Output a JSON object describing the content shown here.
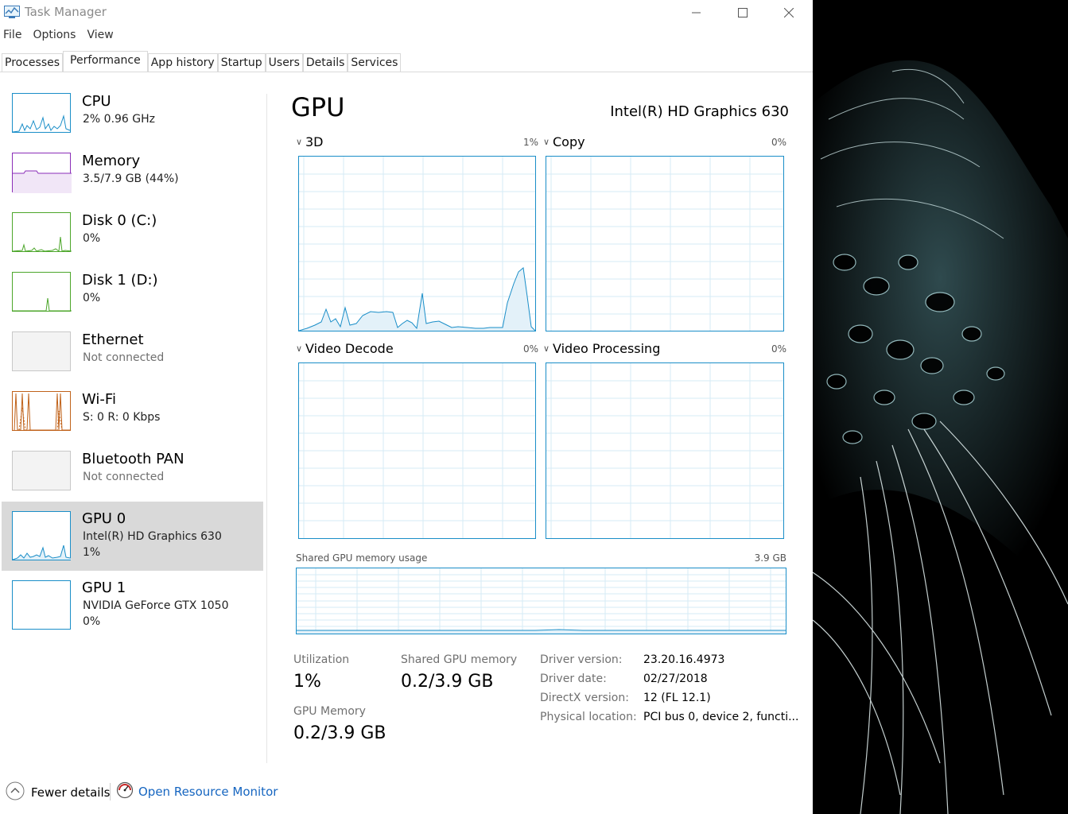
{
  "window": {
    "title": "Task Manager",
    "controls": {
      "minimize": "minimize-icon",
      "maximize": "maximize-icon",
      "close": "close-icon"
    }
  },
  "menu": {
    "items": [
      "File",
      "Options",
      "View"
    ]
  },
  "tabs": {
    "items": [
      "Processes",
      "Performance",
      "App history",
      "Startup",
      "Users",
      "Details",
      "Services"
    ],
    "active": "Performance"
  },
  "sidebar": {
    "items": [
      {
        "name": "CPU",
        "sub1": "2%  0.96 GHz",
        "sub2": "",
        "color": "#1a8ec8"
      },
      {
        "name": "Memory",
        "sub1": "3.5/7.9 GB (44%)",
        "sub2": "",
        "color": "#8b2eb8"
      },
      {
        "name": "Disk 0 (C:)",
        "sub1": "0%",
        "sub2": "",
        "color": "#4ca62a"
      },
      {
        "name": "Disk 1 (D:)",
        "sub1": "0%",
        "sub2": "",
        "color": "#4ca62a"
      },
      {
        "name": "Ethernet",
        "sub1": "Not connected",
        "sub2": "",
        "color": "#a0a0a0"
      },
      {
        "name": "Wi-Fi",
        "sub1": "S: 0 R: 0 Kbps",
        "sub2": "",
        "color": "#c0621a"
      },
      {
        "name": "Bluetooth PAN",
        "sub1": "Not connected",
        "sub2": "",
        "color": "#a0a0a0"
      },
      {
        "name": "GPU 0",
        "sub1": "Intel(R) HD Graphics 630",
        "sub2": "1%",
        "color": "#1a8ec8"
      },
      {
        "name": "GPU 1",
        "sub1": "NVIDIA GeForce GTX 1050",
        "sub2": "0%",
        "color": "#1a8ec8"
      }
    ],
    "selected_index": 7
  },
  "gpu": {
    "title": "GPU",
    "model": "Intel(R) HD Graphics 630",
    "engines": [
      {
        "name": "3D",
        "percent": "1%"
      },
      {
        "name": "Copy",
        "percent": "0%"
      },
      {
        "name": "Video Decode",
        "percent": "0%"
      },
      {
        "name": "Video Processing",
        "percent": "0%"
      }
    ],
    "shared_memory_label": "Shared GPU memory usage",
    "shared_memory_max": "3.9 GB",
    "stats": {
      "utilization_label": "Utilization",
      "utilization_value": "1%",
      "shared_label": "Shared GPU memory",
      "shared_value": "0.2/3.9 GB",
      "gpu_memory_label": "GPU Memory",
      "gpu_memory_value": "0.2/3.9 GB"
    },
    "info": {
      "driver_version_label": "Driver version:",
      "driver_version": "23.20.16.4973",
      "driver_date_label": "Driver date:",
      "driver_date": "02/27/2018",
      "directx_label": "DirectX version:",
      "directx": "12 (FL 12.1)",
      "location_label": "Physical location:",
      "location": "PCI bus 0, device 2, functi..."
    }
  },
  "footer": {
    "fewer_details": "Fewer details",
    "open_monitor": "Open Resource Monitor"
  },
  "colors": {
    "gpu_accent": "#1a8ec8",
    "selected_bg": "#d9d9d9",
    "link": "#1565c0"
  }
}
